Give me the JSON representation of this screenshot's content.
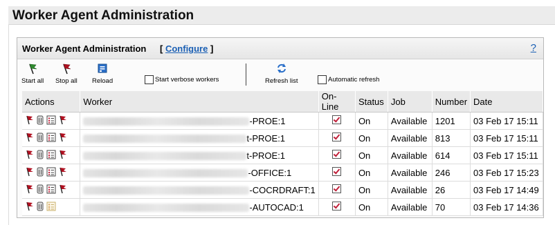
{
  "page": {
    "title": "Worker Agent Administration"
  },
  "panel": {
    "title": "Worker Agent Administration",
    "bracket_open": "[",
    "configure_label": "Configure",
    "bracket_close": "]",
    "help_label": "?"
  },
  "toolbar": {
    "start_all": "Start all",
    "stop_all": "Stop all",
    "reload": "Reload",
    "verbose": "Start verbose workers",
    "refresh": "Refresh list",
    "auto_refresh": "Automatic refresh"
  },
  "table": {
    "headers": [
      "Actions",
      "Worker",
      "On-Line",
      "Status",
      "Job",
      "Number",
      "Date"
    ],
    "rows": [
      {
        "worker_suffix": "-PROE:1",
        "status": "On",
        "job": "Available",
        "number": "1201",
        "date": "03 Feb 17 15:11"
      },
      {
        "worker_suffix": "t-PROE:1",
        "status": "On",
        "job": "Available",
        "number": "813",
        "date": "03 Feb 17 15:11"
      },
      {
        "worker_suffix": "t-PROE:1",
        "status": "On",
        "job": "Available",
        "number": "614",
        "date": "03 Feb 17 15:11"
      },
      {
        "worker_suffix": "-OFFICE:1",
        "status": "On",
        "job": "Available",
        "number": "246",
        "date": "03 Feb 17 15:23"
      },
      {
        "worker_suffix": "-COCRDRAFT:1",
        "status": "On",
        "job": "Available",
        "number": "26",
        "date": "03 Feb 17 14:49"
      },
      {
        "worker_suffix": "-AUTOCAD:1",
        "status": "On",
        "job": "Available",
        "number": "70",
        "date": "03 Feb 17 14:36"
      }
    ]
  },
  "icons": {
    "start": "green-flag-icon",
    "stop": "red-flag-icon",
    "reload": "reload-icon",
    "refresh": "refresh-arrows-icon",
    "row_actions": [
      "stop-flag-icon",
      "log-file-icon",
      "details-list-icon",
      "restart-flag-icon"
    ]
  },
  "colors": {
    "accent_link": "#1a5fb4",
    "flag_red": "#b01020",
    "flag_green": "#2e8b2e"
  }
}
